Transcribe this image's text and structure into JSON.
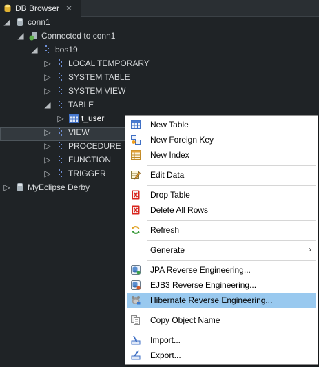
{
  "view_tab": {
    "title": "DB Browser",
    "close_icon": "close-icon"
  },
  "tree": {
    "conn": "conn1",
    "connected": "Connected to conn1",
    "schema": "bos19",
    "folders": {
      "local_temporary": "LOCAL TEMPORARY",
      "system_table": "SYSTEM TABLE",
      "system_view": "SYSTEM VIEW",
      "table": "TABLE",
      "view": "VIEW",
      "procedure": "PROCEDURE",
      "function": "FUNCTION",
      "trigger": "TRIGGER"
    },
    "table_item": "t_user",
    "other_conn": "MyEclipse Derby"
  },
  "menu": {
    "new_table": "New Table",
    "new_foreign_key": "New Foreign Key",
    "new_index": "New Index",
    "edit_data": "Edit Data",
    "drop_table": "Drop Table",
    "delete_all_rows": "Delete All Rows",
    "refresh": "Refresh",
    "generate": "Generate",
    "jpa_reverse": "JPA Reverse Engineering...",
    "ejb3_reverse": "EJB3 Reverse Engineering...",
    "hibernate_reverse": "Hibernate Reverse Engineering...",
    "copy_object_name": "Copy Object Name",
    "import": "Import...",
    "export": "Export..."
  },
  "colors": {
    "background": "#1f2326",
    "menu_highlight": "#99c9ef",
    "folder_icon": "#6f8fd6",
    "connected_icon": "#5fb04d"
  }
}
